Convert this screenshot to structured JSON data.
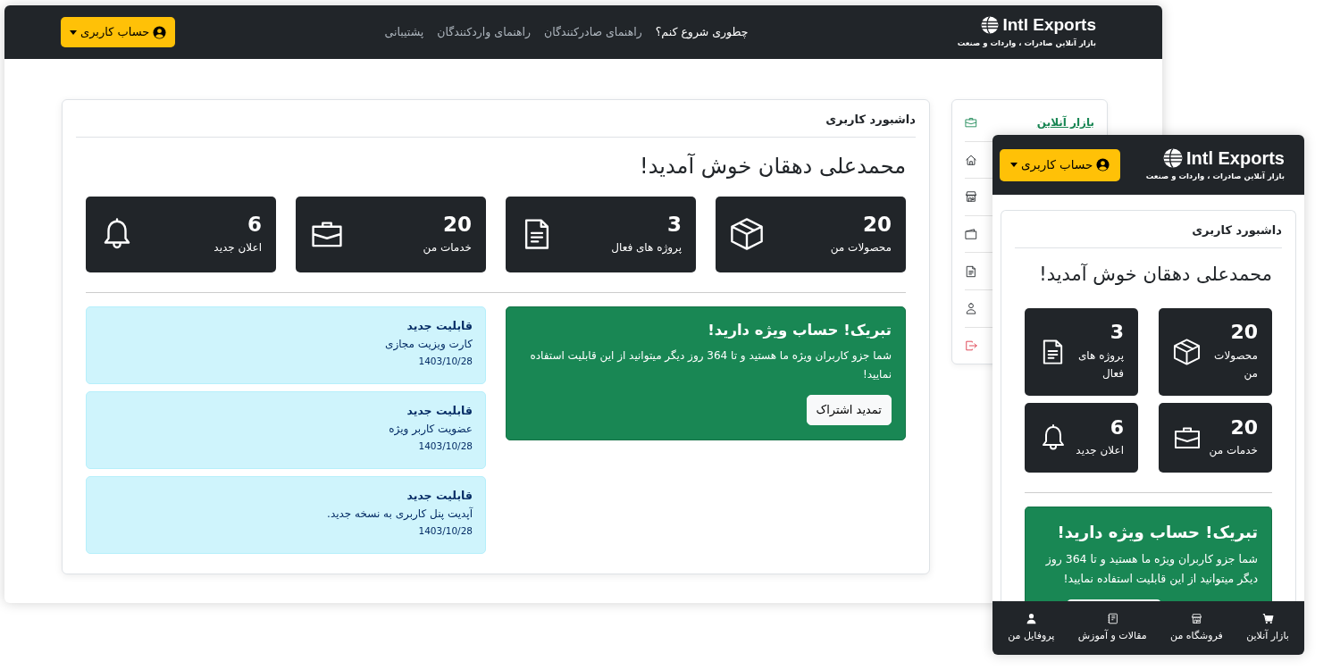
{
  "desktop": {
    "brand": {
      "name": "Intl Exports",
      "tagline": "بازار آنلاین صادرات ، واردات و صنعت"
    },
    "nav_links": [
      {
        "label": "چطوری شروع کنم؟",
        "selected": true
      },
      {
        "label": "راهنمای صادرکنندگان",
        "selected": false
      },
      {
        "label": "راهنمای واردکنندگان",
        "selected": false
      },
      {
        "label": "پشتیبانی",
        "selected": false
      }
    ],
    "account_button": "حساب کاربری",
    "sidebar": [
      {
        "label": "بازار آنلاین",
        "selected": true,
        "kind": "link"
      },
      {
        "selected": false,
        "kind": "link"
      },
      {
        "selected": false,
        "kind": "link"
      },
      {
        "selected": false,
        "kind": "link"
      },
      {
        "selected": false,
        "kind": "link"
      },
      {
        "selected": false,
        "kind": "link"
      },
      {
        "selected": false,
        "kind": "logout"
      }
    ],
    "dashboard": {
      "title": "داشبورد کاربری",
      "greeting": "محمدعلی دهقان خوش آمدید!",
      "stats": [
        {
          "value": "20",
          "label": "محصولات من"
        },
        {
          "value": "3",
          "label": "پروژه های فعال"
        },
        {
          "value": "20",
          "label": "خدمات من"
        },
        {
          "value": "6",
          "label": "اعلان جدید"
        }
      ],
      "promo": {
        "title": "تبریک! حساب ویژه دارید!",
        "text": "شما جزو کاربران ویژه ما هستید و تا 364 روز دیگر میتوانید از این قابلیت استفاده نمایید!",
        "button": "تمدید اشتراک"
      },
      "features": [
        {
          "title": "قابلیت جدید",
          "text": "کارت ویزیت مجازی",
          "date": "1403/10/28"
        },
        {
          "title": "قابلیت جدید",
          "text": "عضویت کاربر ویژه",
          "date": "1403/10/28"
        },
        {
          "title": "قابلیت جدید",
          "text": "آپدیت پنل کاربری به نسخه جدید.",
          "date": "1403/10/28"
        }
      ]
    }
  },
  "mobile": {
    "brand": {
      "name": "Intl Exports",
      "tagline": "بازار آنلاین صادرات ، واردات و صنعت"
    },
    "account_button": "حساب کاربری",
    "dashboard": {
      "title": "داشبورد کاربری",
      "greeting": "محمدعلی دهقان خوش آمدید!",
      "stats": [
        {
          "value": "20",
          "label": "محصولات من"
        },
        {
          "value": "3",
          "label": "پروژه های فعال"
        },
        {
          "value": "20",
          "label": "خدمات من"
        },
        {
          "value": "6",
          "label": "اعلان جدید"
        }
      ],
      "promo": {
        "title": "تبریک! حساب ویژه دارید!",
        "text": "شما جزو کاربران ویژه ما هستید و تا 364 روز دیگر میتوانید از این قابلیت استفاده نمایید!",
        "button_partly_hidden": true
      }
    },
    "bottom_nav": [
      {
        "label": "بازار آنلاین"
      },
      {
        "label": "فروشگاه من"
      },
      {
        "label": "مقالات و آموزش"
      },
      {
        "label": "پروفایل من"
      }
    ]
  }
}
